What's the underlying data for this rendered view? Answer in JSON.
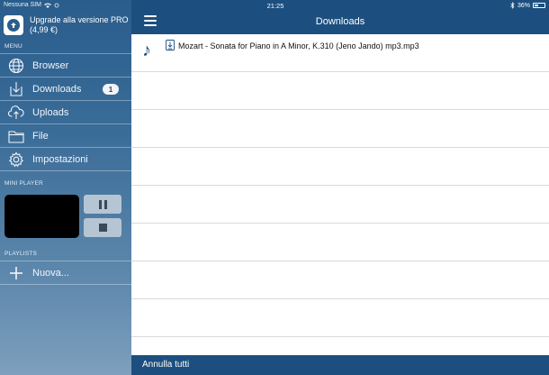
{
  "status_bar": {
    "carrier": "Nessuna SIM",
    "time": "21:25",
    "battery": "36%"
  },
  "upgrade": {
    "line1": "Upgrade alla versione PRO",
    "line2": "(4,99 €)"
  },
  "sidebar": {
    "menu_label": "MENU",
    "items": [
      {
        "label": "Browser",
        "icon": "globe-icon"
      },
      {
        "label": "Downloads",
        "icon": "download-icon",
        "badge": "1"
      },
      {
        "label": "Uploads",
        "icon": "cloud-upload-icon"
      },
      {
        "label": "File",
        "icon": "folder-icon"
      },
      {
        "label": "Impostazioni",
        "icon": "gear-icon"
      }
    ],
    "mini_player_label": "MINI PLAYER",
    "playlists_label": "PLAYLISTS",
    "new_playlist": "Nuova..."
  },
  "navbar": {
    "title": "Downloads"
  },
  "downloads": [
    {
      "name": "Mozart - Sonata for Piano in A Minor, K.310 (Jeno Jando) mp3.mp3"
    }
  ],
  "bottom_bar": {
    "cancel_all": "Annulla tutti"
  },
  "colors": {
    "navbar": "#1c4f7f",
    "sidebar_top": "#2a5d8c",
    "sidebar_bottom": "#7e9fbd"
  }
}
